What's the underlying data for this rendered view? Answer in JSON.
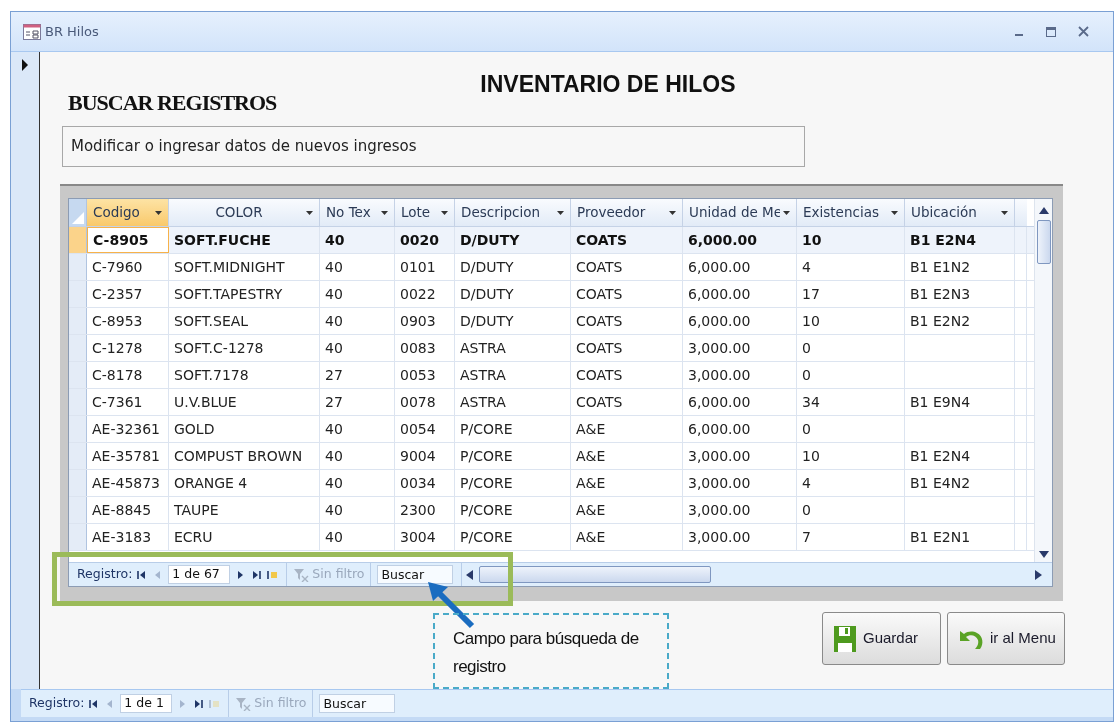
{
  "window": {
    "title": "BR Hilos"
  },
  "form": {
    "title": "INVENTARIO DE HILOS",
    "heading": "BUSCAR REGISTROS",
    "subtitle": "Modificar o ingresar datos de nuevos ingresos"
  },
  "table": {
    "columns": [
      {
        "label": "Codigo",
        "selected": true
      },
      {
        "label": "COLOR",
        "selected": false
      },
      {
        "label": "No Tex",
        "selected": false
      },
      {
        "label": "Lote",
        "selected": false
      },
      {
        "label": "Descripcion",
        "selected": false
      },
      {
        "label": "Proveedor",
        "selected": false
      },
      {
        "label": "Unidad de Me",
        "selected": false
      },
      {
        "label": "Existencias",
        "selected": false
      },
      {
        "label": "Ubicación",
        "selected": false
      }
    ],
    "rows": [
      {
        "selected": true,
        "cells": [
          "C-8905",
          "SOFT.FUCHE",
          "40",
          "0020",
          "D/DUTY",
          "COATS",
          "6,000.00",
          "10",
          "B1 E2N4"
        ]
      },
      {
        "selected": false,
        "cells": [
          "C-7960",
          "SOFT.MIDNIGHT",
          "40",
          "0101",
          "D/DUTY",
          "COATS",
          "6,000.00",
          "4",
          "B1 E1N2"
        ]
      },
      {
        "selected": false,
        "cells": [
          "C-2357",
          "SOFT.TAPESTRY",
          "40",
          "0022",
          "D/DUTY",
          "COATS",
          "6,000.00",
          "17",
          "B1 E2N3"
        ]
      },
      {
        "selected": false,
        "cells": [
          "C-8953",
          "SOFT.SEAL",
          "40",
          "0903",
          "D/DUTY",
          "COATS",
          "6,000.00",
          "10",
          "B1 E2N2"
        ]
      },
      {
        "selected": false,
        "cells": [
          "C-1278",
          "SOFT.C-1278",
          "40",
          "0083",
          "ASTRA",
          "COATS",
          "3,000.00",
          "0",
          ""
        ]
      },
      {
        "selected": false,
        "cells": [
          "C-8178",
          "SOFT.7178",
          "27",
          "0053",
          "ASTRA",
          "COATS",
          "3,000.00",
          "0",
          ""
        ]
      },
      {
        "selected": false,
        "cells": [
          "C-7361",
          "U.V.BLUE",
          "27",
          "0078",
          "ASTRA",
          "COATS",
          "6,000.00",
          "34",
          "B1 E9N4"
        ]
      },
      {
        "selected": false,
        "cells": [
          "AE-32361",
          "GOLD",
          "40",
          "0054",
          "P/CORE",
          "A&E",
          "6,000.00",
          "0",
          ""
        ]
      },
      {
        "selected": false,
        "cells": [
          "AE-35781",
          "COMPUST BROWN",
          "40",
          "9004",
          "P/CORE",
          "A&E",
          "3,000.00",
          "10",
          "B1 E2N4"
        ]
      },
      {
        "selected": false,
        "cells": [
          "AE-45873",
          "ORANGE 4",
          "40",
          "0034",
          "P/CORE",
          "A&E",
          "3,000.00",
          "4",
          "B1 E4N2"
        ]
      },
      {
        "selected": false,
        "cells": [
          "AE-8845",
          "TAUPE",
          "40",
          "2300",
          "P/CORE",
          "A&E",
          "3,000.00",
          "0",
          ""
        ]
      },
      {
        "selected": false,
        "cells": [
          "AE-3183",
          "ECRU",
          "40",
          "3004",
          "P/CORE",
          "A&E",
          "3,000.00",
          "7",
          "B1 E2N1"
        ]
      }
    ]
  },
  "grid_navigator": {
    "label": "Registro:",
    "position": "1 de 67",
    "buttons": [
      {
        "kind": "first",
        "disabled": false
      },
      {
        "kind": "prev",
        "disabled": true
      },
      {
        "kind": "next",
        "disabled": false
      },
      {
        "kind": "last",
        "disabled": false
      },
      {
        "kind": "new",
        "disabled": false
      }
    ],
    "filter": "Sin filtro",
    "search": {
      "placeholder": "Buscar"
    }
  },
  "callout": {
    "text": "Campo para búsqueda de registro"
  },
  "buttons": [
    {
      "kind": "save",
      "label": "Guardar"
    },
    {
      "kind": "undo",
      "label": "ir al Menu"
    }
  ],
  "form_navigator": {
    "label": "Registro:",
    "position": "1 de 1",
    "buttons": [
      {
        "kind": "first",
        "disabled": false
      },
      {
        "kind": "prev",
        "disabled": true
      },
      {
        "kind": "next",
        "disabled": true
      },
      {
        "kind": "last",
        "disabled": false
      },
      {
        "kind": "new",
        "disabled": true
      }
    ],
    "filter": "Sin filtro",
    "search": {
      "placeholder": "Buscar"
    }
  }
}
